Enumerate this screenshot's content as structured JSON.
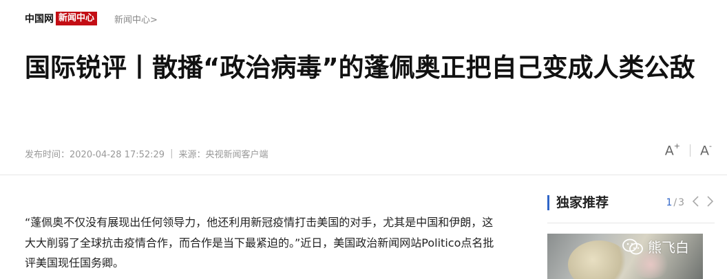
{
  "header": {
    "brand": "中国网",
    "channel": "新闻中心",
    "breadcrumb": "新闻中心>"
  },
  "article": {
    "title": "国际锐评丨散播“政治病毒”的蓬佩奥正把自己变成人类公敌",
    "publish_time_label": "发布时间：2020-04-28 17:52:29",
    "source_label": "来源：央视新闻客户端",
    "meta_separator": "|",
    "body": "“蓬佩奥不仅没有展现出任何领导力，他还利用新冠疫情打击美国的对手，尤其是中国和伊朗，这大大削弱了全球抗击疫情合作，而合作是当下最紧迫的。”近日，美国政治新闻网站Politico点名批评美国现任国务卿。"
  },
  "font_tools": {
    "increase_label": "A",
    "increase_mark": "+",
    "decrease_label": "A",
    "decrease_mark": "-"
  },
  "sidebar": {
    "title": "独家推荐",
    "pager_current": "1",
    "pager_separator": "/",
    "pager_total": "3",
    "prev_icon": "chevron-left-icon",
    "next_icon": "chevron-right-icon",
    "card_watermark": "熊飞白"
  },
  "colors": {
    "brand_red": "#c30d14",
    "accent_blue": "#2f65c8",
    "meta_gray": "#999999"
  }
}
